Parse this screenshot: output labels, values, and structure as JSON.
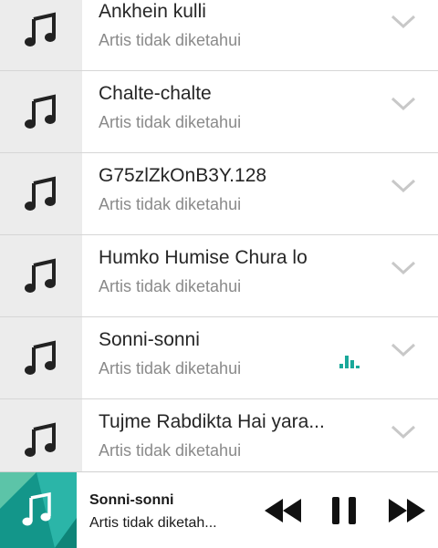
{
  "songs": [
    {
      "title": "Ankhein kulli",
      "artist": "Artis tidak diketahui",
      "playing": false
    },
    {
      "title": "Chalte-chalte",
      "artist": "Artis tidak diketahui",
      "playing": false
    },
    {
      "title": "G75zlZkOnB3Y.128",
      "artist": "Artis tidak diketahui",
      "playing": false
    },
    {
      "title": "Humko Humise Chura lo",
      "artist": "Artis tidak diketahui",
      "playing": false
    },
    {
      "title": "Sonni-sonni",
      "artist": "Artis tidak diketahui",
      "playing": true
    },
    {
      "title": "Tujme Rabdikta Hai yara...",
      "artist": "Artis tidak diketahui",
      "playing": false
    }
  ],
  "player": {
    "title": "Sonni-sonni",
    "artist": "Artis tidak diketah...",
    "controls": {
      "prev_icon": "previous-icon",
      "pause_icon": "pause-icon",
      "next_icon": "next-icon"
    }
  },
  "colors": {
    "accent": "#1aa89a",
    "thumb_bg": "#ececec",
    "icon_dark": "#222222",
    "chevron": "#c8c8c8"
  },
  "icons": {
    "song": "music-note-icon",
    "expand": "chevron-down-icon",
    "equalizer": "equalizer-icon"
  }
}
